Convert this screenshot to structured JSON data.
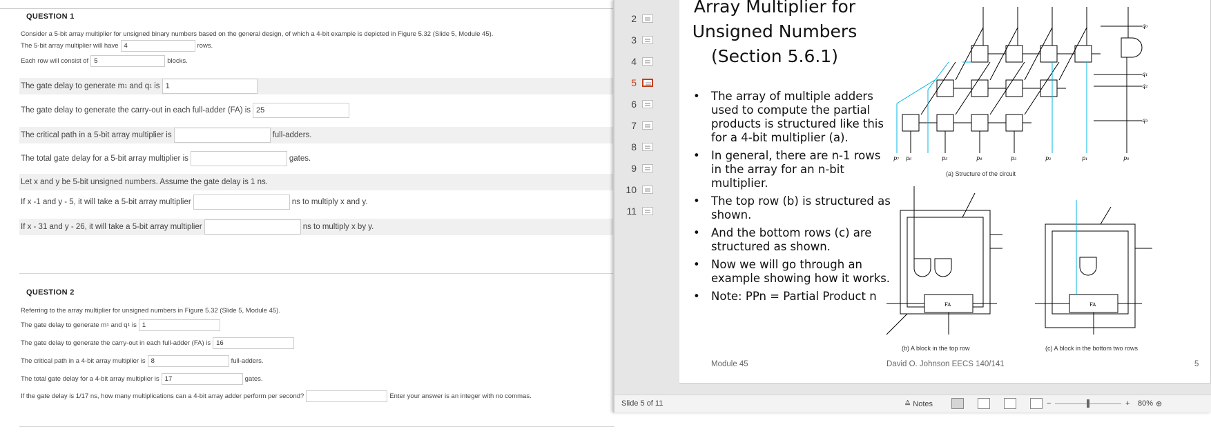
{
  "q1": {
    "heading": "QUESTION 1",
    "intro": "Consider a 5-bit array multiplier for unsigned binary numbers based on the general design, of which a 4-bit example is depicted in Figure 5.32 (Slide 5, Module 45).",
    "rows_pre": "The 5-bit array multiplier will have",
    "rows_val": "4",
    "rows_post": "rows.",
    "blocks_pre": "Each row will consist of",
    "blocks_val": "5",
    "blocks_post": "blocks.",
    "gate_m_pre": "The gate delay to generate m",
    "gate_m_mid": "and q",
    "gate_m_is": "is",
    "sub1": "1",
    "gate_m_val": "1",
    "carry_pre": "The gate delay to generate the carry-out in each full-adder (FA) is",
    "carry_val": "25",
    "crit_pre": "The critical path in a 5-bit array multiplier is",
    "crit_val": "",
    "crit_post": "full-adders.",
    "total_pre": "The total gate delay for a 5-bit array multiplier is",
    "total_val": "",
    "total_post": "gates.",
    "assume": "Let x and y be 5-bit unsigned numbers. Assume the gate delay is 1 ns.",
    "ex1_pre": "If x -1 and y - 5, it will take a 5-bit array multiplier",
    "ex1_val": "",
    "ex1_post": "ns to multiply x and y.",
    "ex2_pre": "If x - 31 and y - 26, it will take a 5-bit array multiplier",
    "ex2_val": "",
    "ex2_post": "ns to multiply x by y."
  },
  "q2": {
    "heading": "QUESTION 2",
    "intro": "Referring to the array multiplier for unsigned numbers in Figure 5.32 (Slide 5, Module 45).",
    "gate_m_pre": "The gate delay to generate m",
    "gate_m_mid": "and q",
    "gate_m_is": "is",
    "sub1": "1",
    "gate_m_val": "1",
    "carry_pre": "The gate delay to generate the carry-out in each full-adder (FA) is",
    "carry_val": "16",
    "crit_pre": "The critical path in a 4-bit array multiplier is",
    "crit_val": "8",
    "crit_post": "full-adders.",
    "total_pre": "The total gate delay for a 4-bit array multiplier is",
    "total_val": "17",
    "total_post": "gates.",
    "rate_pre": "If the gate delay is 1/17 ns, how many multiplications can a 4-bit array adder perform per second?",
    "rate_val": "",
    "rate_post": "Enter your answer is an integer with no commas."
  },
  "ppt": {
    "thumbs": [
      {
        "n": "2"
      },
      {
        "n": "3"
      },
      {
        "n": "4"
      },
      {
        "n": "5"
      },
      {
        "n": "6"
      },
      {
        "n": "7"
      },
      {
        "n": "8"
      },
      {
        "n": "9"
      },
      {
        "n": "10"
      },
      {
        "n": "11"
      }
    ],
    "active_slide": "5",
    "title": "Array Multiplier for Unsigned Numbers (Section 5.6.1)",
    "bullets": [
      "The array of multiple adders used to compute the partial products is structured like this for a 4-bit multiplier (a).",
      "In general, there are n-1 rows in the array for an n-bit multiplier.",
      "The top row (b) is structured as shown.",
      "And the bottom rows (c) are structured as shown.",
      "Now we will go through an example showing how it works.",
      "Note: PPn = Partial Product n"
    ],
    "caption_a": "(a) Structure of the circuit",
    "caption_b": "(b) A block in the top row",
    "caption_c": "(c) A block in the bottom two rows",
    "footer_left": "Module 45",
    "footer_mid": "David O. Johnson EECS 140/141",
    "footer_num": "5",
    "status_slide": "Slide 5 of 11",
    "notes_label": "Notes",
    "zoom": "80%"
  },
  "colors": {
    "accent_red": "#c43e1c",
    "diagram_cyan": "#00b7e0"
  }
}
